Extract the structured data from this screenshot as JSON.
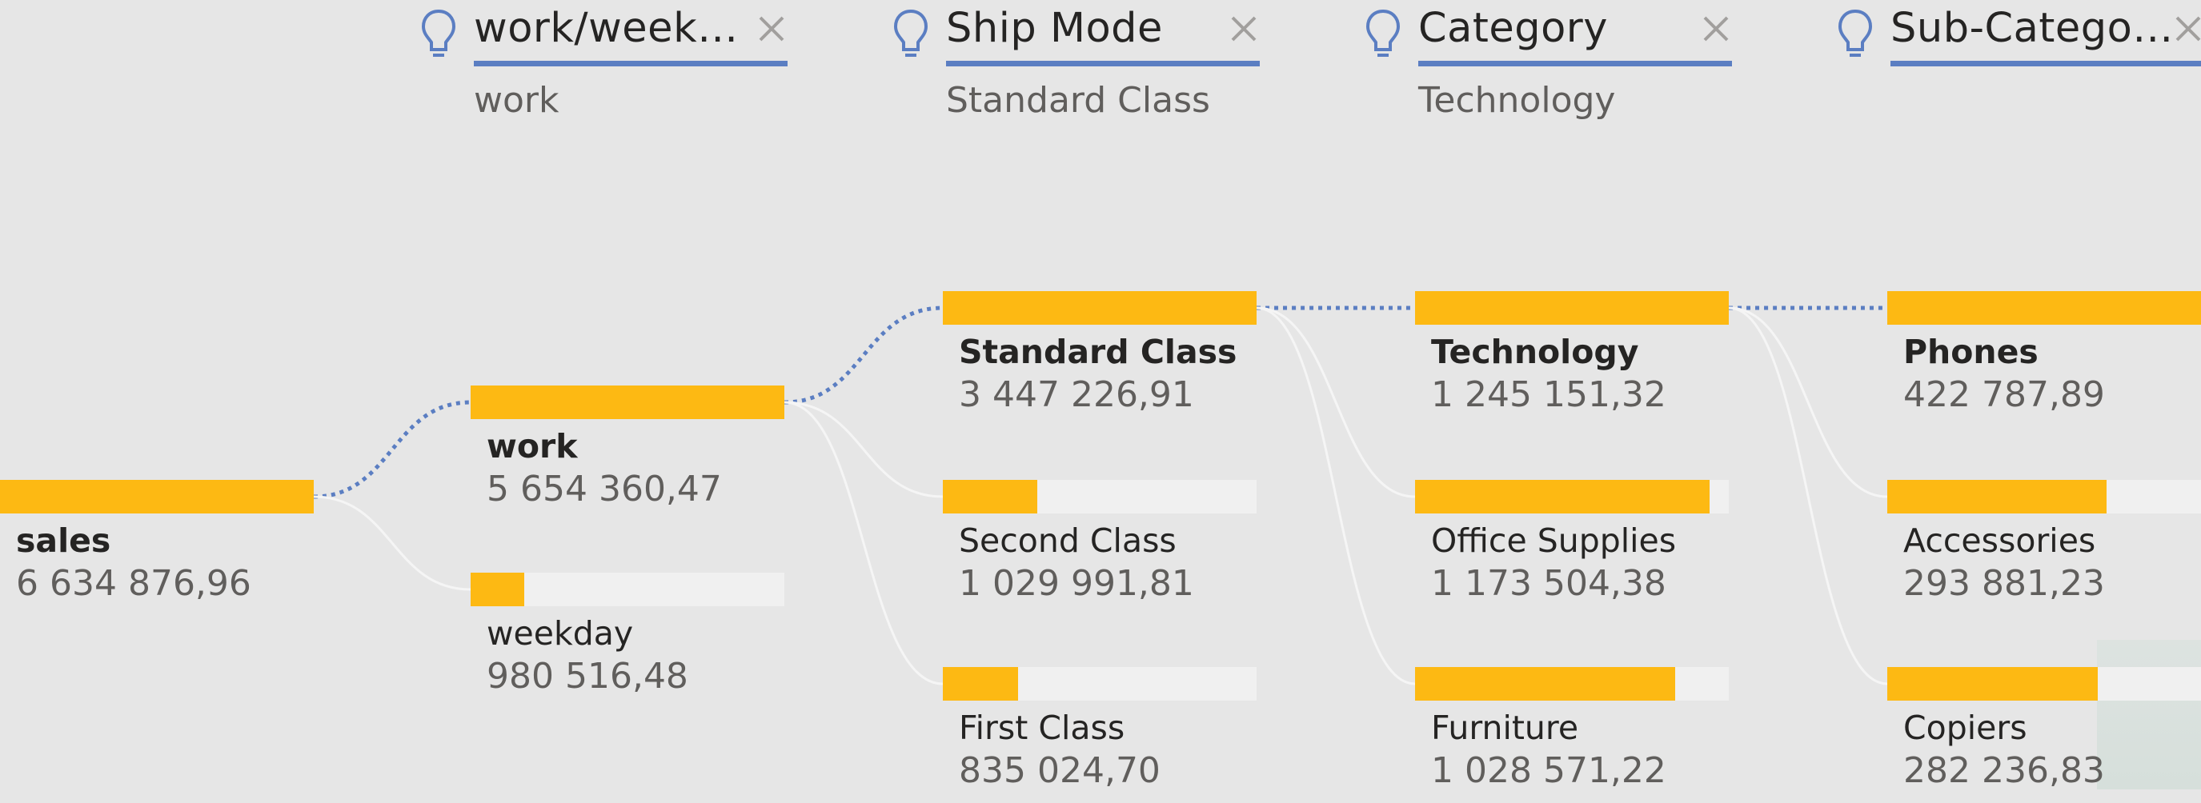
{
  "colors": {
    "bar_fill": "#fdb913",
    "bar_track": "#f0f0f0",
    "accent": "#5b7ec2",
    "background": "#e6e6e6",
    "connector": "#f5f5f5"
  },
  "columns": [
    {
      "title": "work/week…",
      "selected": "work",
      "icon": "lightbulb-icon",
      "close_icon": "close-icon"
    },
    {
      "title": "Ship Mode",
      "selected": "Standard Class",
      "icon": "lightbulb-icon",
      "close_icon": "close-icon"
    },
    {
      "title": "Category",
      "selected": "Technology",
      "icon": "lightbulb-icon",
      "close_icon": "close-icon"
    },
    {
      "title": "Sub-Catego…",
      "selected": "",
      "icon": "lightbulb-icon",
      "close_icon": "close-icon"
    }
  ],
  "root": {
    "label": "sales",
    "value": "6 634 876,96",
    "fill": 1.0
  },
  "levels": [
    [
      {
        "label": "work",
        "value": "5 654 360,47",
        "fill": 1.0,
        "selected": true
      },
      {
        "label": "weekday",
        "value": "980 516,48",
        "fill": 0.17,
        "selected": false
      }
    ],
    [
      {
        "label": "Standard Class",
        "value": "3 447 226,91",
        "fill": 1.0,
        "selected": true
      },
      {
        "label": "Second Class",
        "value": "1 029 991,81",
        "fill": 0.3,
        "selected": false
      },
      {
        "label": "First Class",
        "value": "835 024,70",
        "fill": 0.24,
        "selected": false
      }
    ],
    [
      {
        "label": "Technology",
        "value": "1 245 151,32",
        "fill": 1.0,
        "selected": true
      },
      {
        "label": "Office Supplies",
        "value": "1 173 504,38",
        "fill": 0.94,
        "selected": false
      },
      {
        "label": "Furniture",
        "value": "1 028 571,22",
        "fill": 0.83,
        "selected": false
      }
    ],
    [
      {
        "label": "Phones",
        "value": "422 787,89",
        "fill": 1.0,
        "selected": true
      },
      {
        "label": "Accessories",
        "value": "293 881,23",
        "fill": 0.7,
        "selected": false
      },
      {
        "label": "Copiers",
        "value": "282 236,83",
        "fill": 0.67,
        "selected": false
      }
    ]
  ]
}
